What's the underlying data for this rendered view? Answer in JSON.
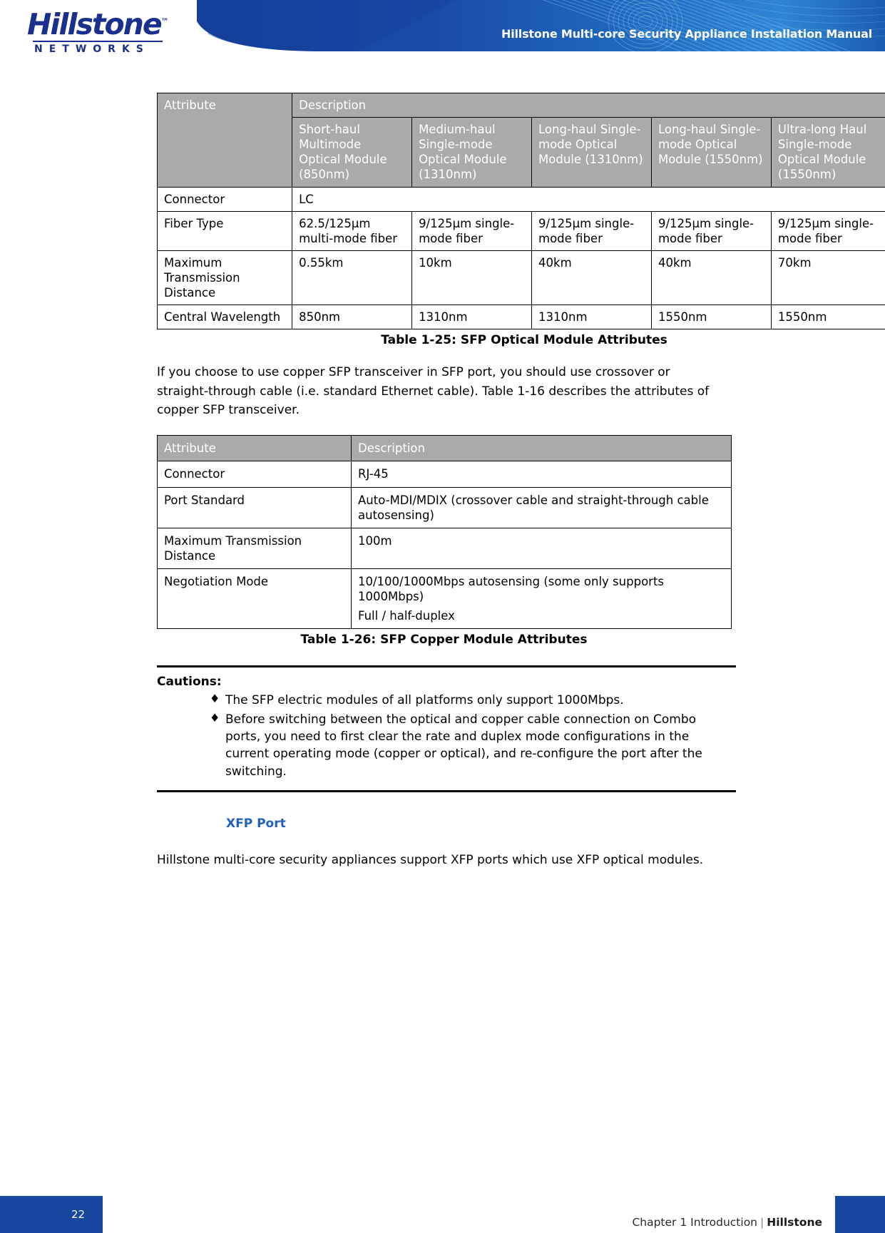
{
  "header": {
    "logo_word": "Hillstone",
    "logo_tm": "™",
    "logo_sub": "NETWORKS",
    "title": "Hillstone Multi-core Security Appliance Installation Manual"
  },
  "table_optical": {
    "group_header": "Description",
    "attribute_header": "Attribute",
    "columns": [
      "Short-haul Multimode Optical Module (850nm)",
      "Medium-haul Single-mode Optical Module (1310nm)",
      "Long-haul Single-mode Optical Module (1310nm)",
      "Long-haul Single-mode Optical Module (1550nm)",
      "Ultra-long Haul Single-mode Optical Module (1550nm)"
    ],
    "rows": [
      {
        "attribute": "Connector",
        "span_all": true,
        "values": [
          "LC"
        ]
      },
      {
        "attribute": "Fiber Type",
        "span_all": false,
        "values": [
          "62.5/125µm multi-mode fiber",
          "9/125µm single-mode fiber",
          "9/125µm single-mode fiber",
          "9/125µm single-mode fiber",
          "9/125µm single-mode fiber"
        ]
      },
      {
        "attribute": "Maximum Transmission Distance",
        "span_all": false,
        "values": [
          "0.55km",
          "10km",
          "40km",
          "40km",
          "70km"
        ]
      },
      {
        "attribute": "Central Wavelength",
        "span_all": false,
        "values": [
          "850nm",
          "1310nm",
          "1310nm",
          "1550nm",
          "1550nm"
        ]
      }
    ],
    "caption": "Table 1-25: SFP Optical Module Attributes"
  },
  "paragraph_copper": "If you choose to use copper SFP transceiver in SFP port, you should use crossover or straight-through cable (i.e. standard Ethernet cable). Table 1-16 describes the attributes of copper SFP transceiver.",
  "table_copper": {
    "headers": [
      "Attribute",
      "Description"
    ],
    "rows": [
      {
        "attribute": "Connector",
        "lines": [
          "RJ-45"
        ]
      },
      {
        "attribute": "Port Standard",
        "lines": [
          "Auto-MDI/MDIX (crossover cable and straight-through cable autosensing)"
        ]
      },
      {
        "attribute": "Maximum Transmission Distance",
        "lines": [
          "100m"
        ]
      },
      {
        "attribute": "Negotiation Mode",
        "lines": [
          "10/100/1000Mbps autosensing (some only supports 1000Mbps)",
          "Full / half-duplex"
        ]
      }
    ],
    "caption": "Table 1-26: SFP Copper Module Attributes"
  },
  "cautions": {
    "title": "Cautions:",
    "items": [
      "The SFP electric modules of all platforms only support 1000Mbps.",
      "Before switching between the optical and copper cable connection on Combo ports, you need to first clear the rate and duplex mode configurations in the current operating mode (copper or optical), and re-configure the port after the switching."
    ],
    "bullet": "♦"
  },
  "xfp_section": {
    "heading": "XFP Port",
    "text": "Hillstone multi-core security appliances support XFP ports which use XFP optical modules."
  },
  "footer": {
    "page_number": "22",
    "chapter": "Chapter 1 Introduction",
    "separator": "|",
    "brand": "Hillstone"
  },
  "colors": {
    "brand_blue": "#17479e",
    "logo_blue": "#1b2f8e",
    "heading_blue": "#1f5fbf",
    "table_header_gray": "#aaaaaa"
  }
}
